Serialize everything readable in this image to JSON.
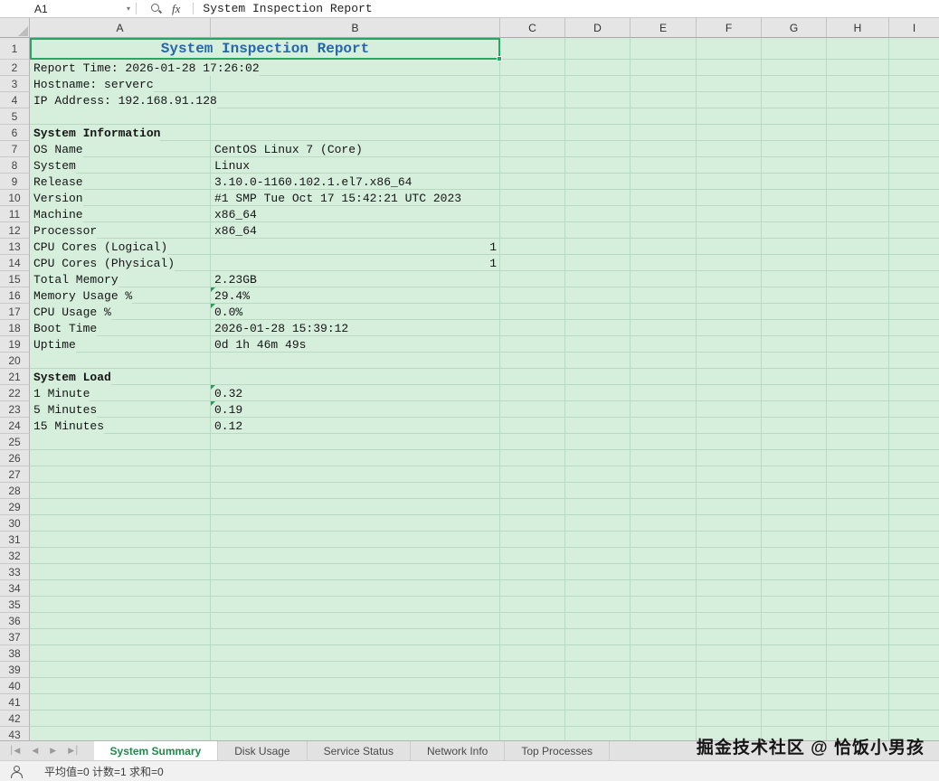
{
  "formula_bar": {
    "name_box": "A1",
    "fx": "fx",
    "content": "System Inspection Report"
  },
  "grid": {
    "columns": [
      "A",
      "B",
      "C",
      "D",
      "E",
      "F",
      "G",
      "H",
      "I"
    ],
    "row_count": 43,
    "title_cell": {
      "ref": "A1",
      "text": "System Inspection Report"
    },
    "cells": [
      {
        "row": 2,
        "a": "Report Time: 2026-01-28 17:26:02"
      },
      {
        "row": 3,
        "a": "Hostname: serverc"
      },
      {
        "row": 4,
        "a": "IP Address: 192.168.91.128"
      },
      {
        "row": 6,
        "a": "System Information",
        "bold": true
      },
      {
        "row": 7,
        "a": "OS Name",
        "b": "CentOS Linux 7 (Core)"
      },
      {
        "row": 8,
        "a": "System",
        "b": "Linux"
      },
      {
        "row": 9,
        "a": "Release",
        "b": "3.10.0-1160.102.1.el7.x86_64"
      },
      {
        "row": 10,
        "a": "Version",
        "b": "#1 SMP Tue Oct 17 15:42:21 UTC 2023"
      },
      {
        "row": 11,
        "a": "Machine",
        "b": "x86_64"
      },
      {
        "row": 12,
        "a": "Processor",
        "b": "x86_64"
      },
      {
        "row": 13,
        "a": "CPU Cores (Logical)",
        "b": "1",
        "b_align": "right"
      },
      {
        "row": 14,
        "a": "CPU Cores (Physical)",
        "b": "1",
        "b_align": "right"
      },
      {
        "row": 15,
        "a": "Total Memory",
        "b": "2.23GB"
      },
      {
        "row": 16,
        "a": "Memory Usage %",
        "b": "29.4%",
        "marker": true
      },
      {
        "row": 17,
        "a": "CPU Usage %",
        "b": "0.0%",
        "marker": true
      },
      {
        "row": 18,
        "a": "Boot Time",
        "b": "2026-01-28 15:39:12"
      },
      {
        "row": 19,
        "a": "Uptime",
        "b": "0d 1h 46m 49s"
      },
      {
        "row": 21,
        "a": "System Load",
        "bold": true
      },
      {
        "row": 22,
        "a": "1 Minute",
        "b": "0.32",
        "marker": true
      },
      {
        "row": 23,
        "a": "5 Minutes",
        "b": "0.19",
        "marker": true
      },
      {
        "row": 24,
        "a": "15 Minutes",
        "b": "0.12"
      }
    ]
  },
  "sheet_tabs": {
    "nav_icons": [
      {
        "name": "first-sheet",
        "glyph": "│◀"
      },
      {
        "name": "prev-sheet",
        "glyph": "◀"
      },
      {
        "name": "next-sheet",
        "glyph": "▶"
      },
      {
        "name": "last-sheet",
        "glyph": "▶│"
      }
    ],
    "tabs": [
      {
        "label": "System Summary",
        "active": true
      },
      {
        "label": "Disk Usage",
        "active": false
      },
      {
        "label": "Service Status",
        "active": false
      },
      {
        "label": "Network Info",
        "active": false
      },
      {
        "label": "Top Processes",
        "active": false
      }
    ]
  },
  "status_bar": {
    "summary": "平均值=0  计数=1  求和=0"
  },
  "watermark": "掘金技术社区 @ 恰饭小男孩",
  "colors": {
    "grid_bg": "#d6efdc",
    "gridline": "#bad9c2",
    "selection_green": "#28a764",
    "title_blue": "#2566ad",
    "active_tab_green": "#1f8a4c"
  }
}
